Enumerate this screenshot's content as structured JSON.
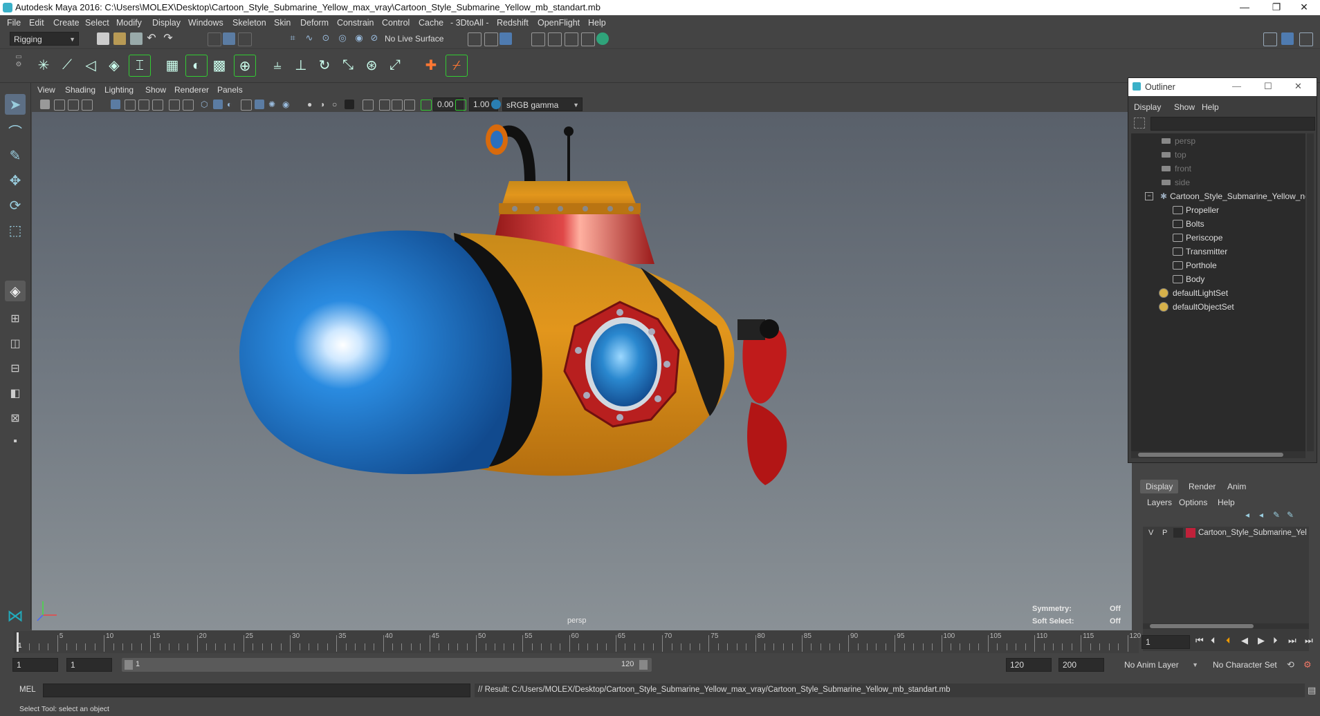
{
  "window": {
    "title": "Autodesk Maya 2016: C:\\Users\\MOLEX\\Desktop\\Cartoon_Style_Submarine_Yellow_max_vray\\Cartoon_Style_Submarine_Yellow_mb_standart.mb",
    "controls": [
      "—",
      "❐",
      "✕"
    ]
  },
  "menubar": [
    "File",
    "Edit",
    "Create",
    "Select",
    "Modify",
    "Display",
    "Windows",
    "Skeleton",
    "Skin",
    "Deform",
    "Constrain",
    "Control",
    "Cache",
    "- 3DtoAll -",
    "Redshift",
    "OpenFlight",
    "Help"
  ],
  "statusline": {
    "menuset": "Rigging",
    "live_surface": "No Live Surface"
  },
  "viewport": {
    "menus": [
      "View",
      "Shading",
      "Lighting",
      "Show",
      "Renderer",
      "Panels"
    ],
    "exposure": "0.00",
    "gamma": "1.00",
    "color_space": "sRGB gamma",
    "camera_label": "persp",
    "symmetry_label": "Symmetry:",
    "symmetry_value": "Off",
    "soft_select_label": "Soft Select:",
    "soft_select_value": "Off"
  },
  "outliner": {
    "title": "Outliner",
    "menus": [
      "Display",
      "Show",
      "Help"
    ],
    "cameras": [
      "persp",
      "top",
      "front",
      "side"
    ],
    "group": "Cartoon_Style_Submarine_Yellow_ncl",
    "children": [
      "Propeller",
      "Bolts",
      "Periscope",
      "Transmitter",
      "Porthole",
      "Body"
    ],
    "sets": [
      "defaultLightSet",
      "defaultObjectSet"
    ]
  },
  "layers": {
    "tabs": [
      "Display",
      "Render",
      "Anim"
    ],
    "menus": [
      "Layers",
      "Options",
      "Help"
    ],
    "layer_v": "V",
    "layer_p": "P",
    "layer_name": "Cartoon_Style_Submarine_Yel",
    "layer_color": "#c0213a"
  },
  "timeline": {
    "ticks": [
      "5",
      "10",
      "15",
      "20",
      "25",
      "30",
      "35",
      "40",
      "45",
      "50",
      "55",
      "60",
      "65",
      "70",
      "75",
      "80",
      "85",
      "90",
      "95",
      "100",
      "105",
      "110",
      "115",
      "120"
    ],
    "start_marker": "1",
    "current_frame": "1"
  },
  "range": {
    "start": "1",
    "inner_start": "1",
    "slider_start": "1",
    "slider_end": "120",
    "end": "120",
    "outer_end": "200",
    "anim_layer": "No Anim Layer",
    "character_set": "No Character Set"
  },
  "command": {
    "lang": "MEL",
    "result": "// Result: C:/Users/MOLEX/Desktop/Cartoon_Style_Submarine_Yellow_max_vray/Cartoon_Style_Submarine_Yellow_mb_standart.mb"
  },
  "help_line": "Select Tool: select an object"
}
